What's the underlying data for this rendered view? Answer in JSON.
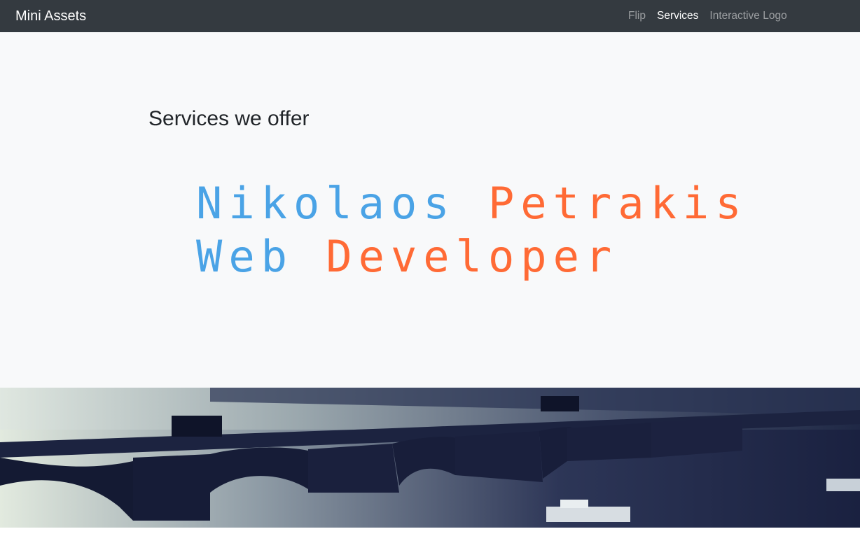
{
  "navbar": {
    "brand": "Mini Assets",
    "links": [
      {
        "label": "Flip",
        "active": false
      },
      {
        "label": "Services",
        "active": true
      },
      {
        "label": "Interactive Logo",
        "active": false
      }
    ]
  },
  "services": {
    "title": "Services we offer",
    "banner_line1": {
      "word1": "Nikolaos",
      "word2": "Petrakis"
    },
    "banner_line2": {
      "word1": "Web",
      "word2": "Developer"
    }
  },
  "colors": {
    "navbar_bg": "#343a40",
    "section_bg": "#f8f9fa",
    "accent_blue": "#4aa3e6",
    "accent_orange": "#ff6a35"
  },
  "hero": {
    "image_subject": "river-bridge-photo"
  }
}
